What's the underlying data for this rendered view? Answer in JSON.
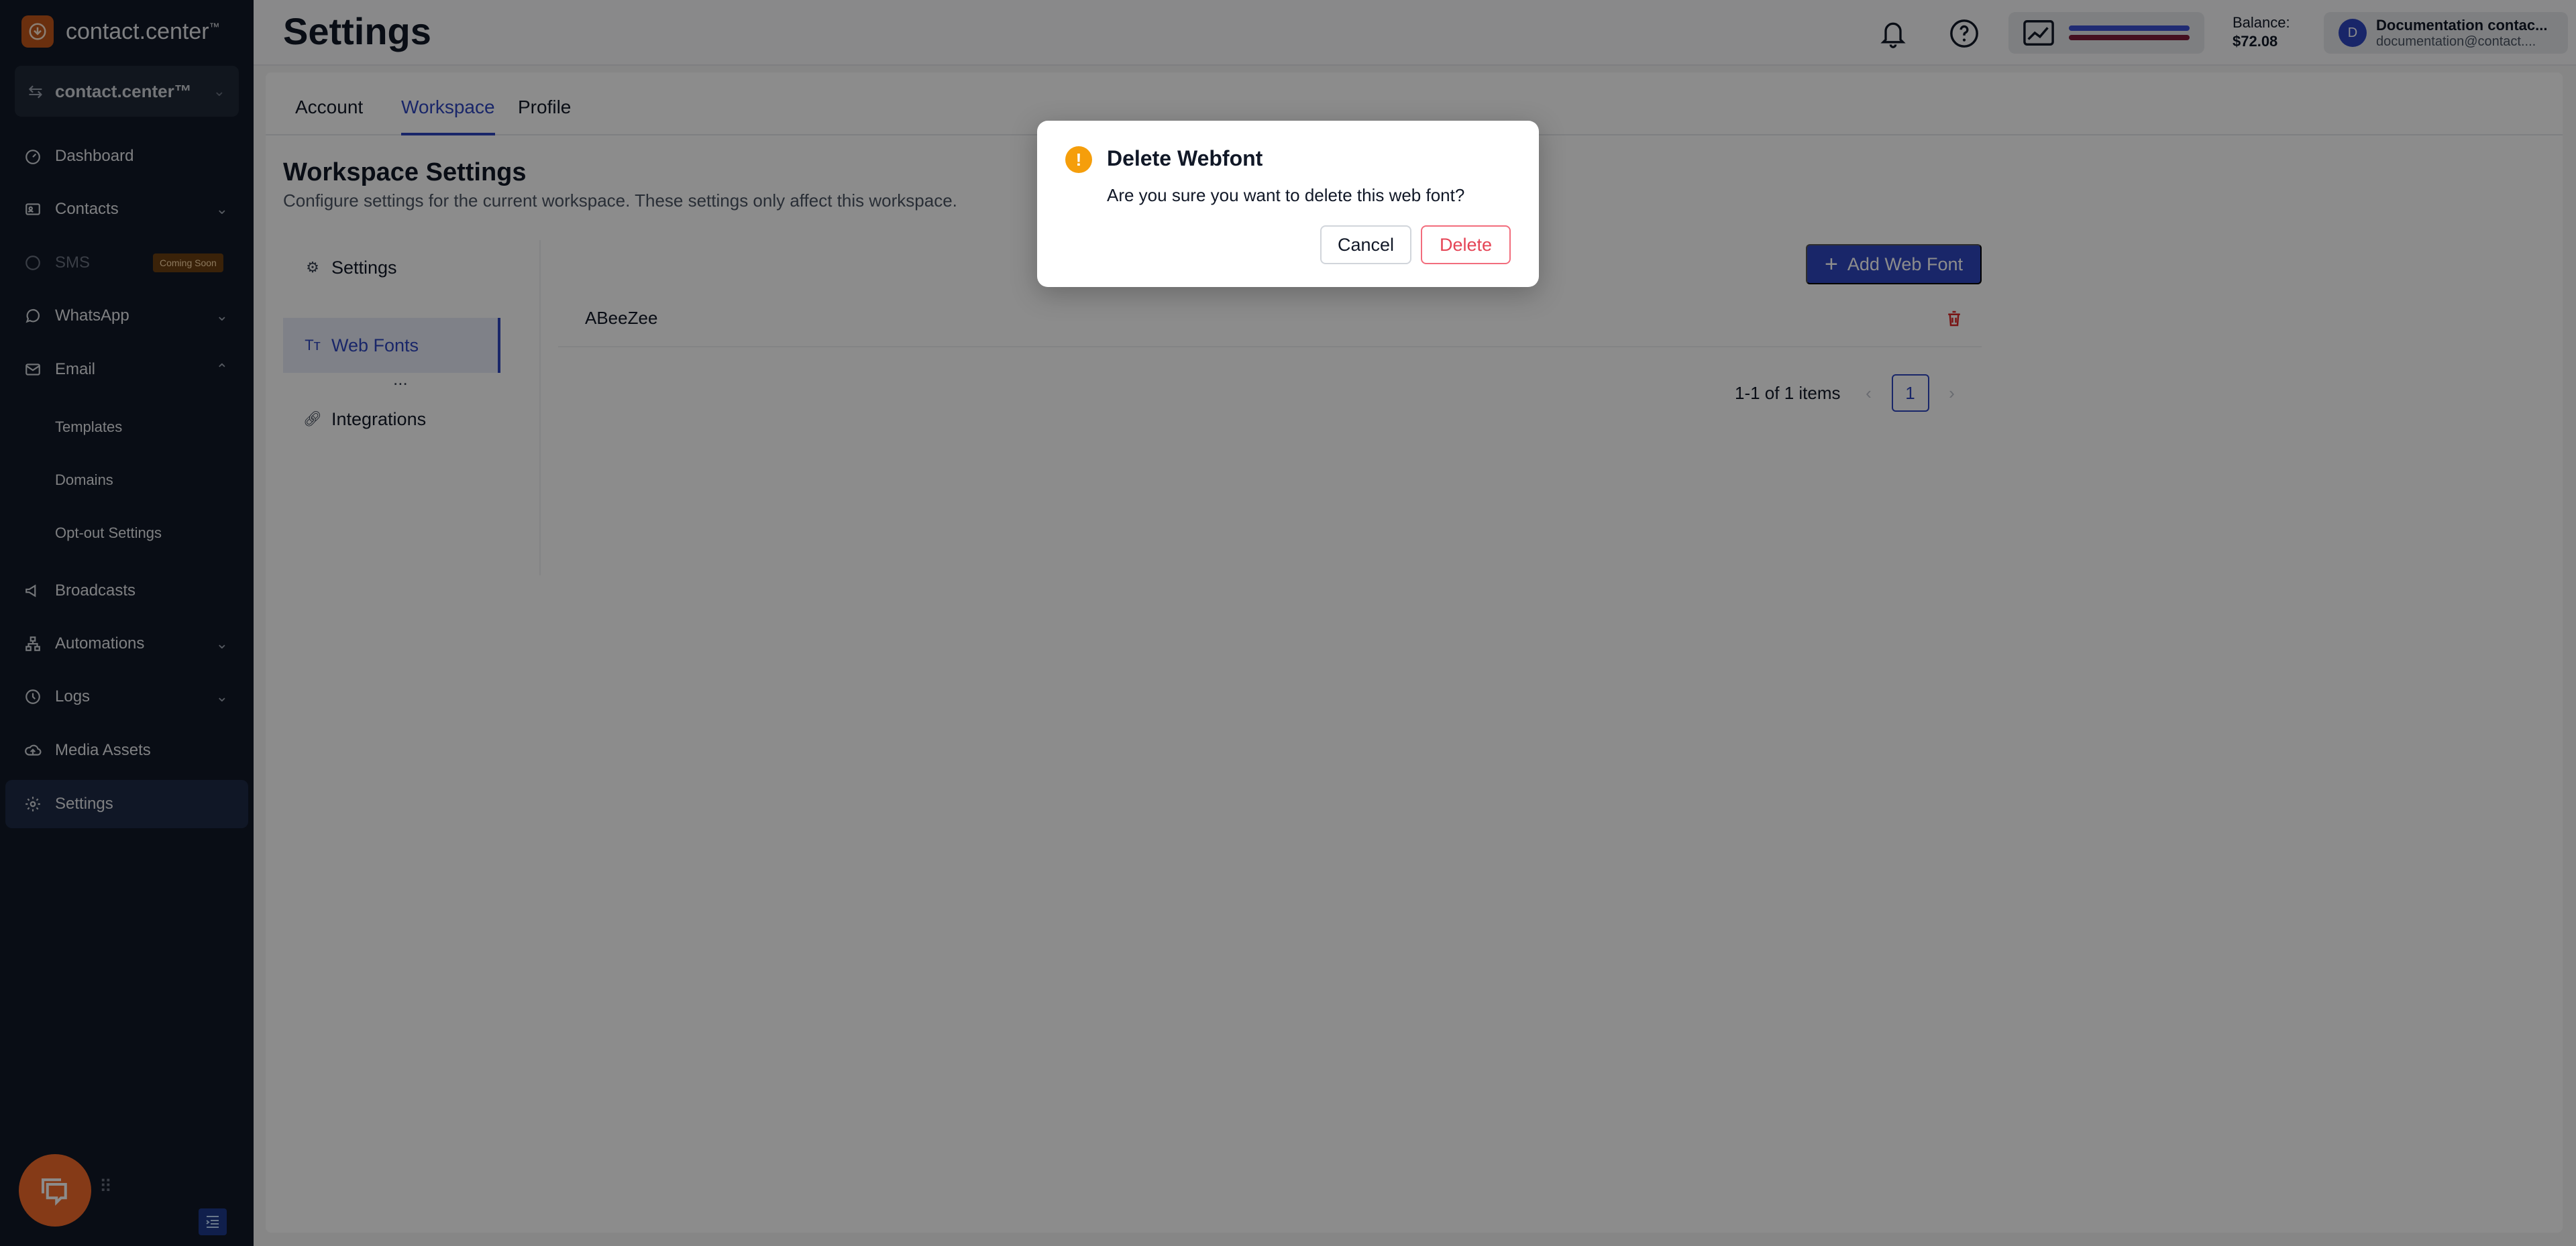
{
  "app": {
    "brand_name": "contact.center",
    "brand_mark": "™",
    "workspace_name": "contact.center™"
  },
  "sidebar": {
    "items": [
      {
        "label": "Dashboard",
        "icon": "dashboard-icon"
      },
      {
        "label": "Contacts",
        "icon": "contacts-icon"
      },
      {
        "label": "SMS",
        "icon": "sms-icon",
        "badge": "Coming Soon"
      },
      {
        "label": "WhatsApp",
        "icon": "whatsapp-icon"
      },
      {
        "label": "Email",
        "icon": "email-icon"
      },
      {
        "label": "Broadcasts",
        "icon": "megaphone-icon"
      },
      {
        "label": "Automations",
        "icon": "automations-icon"
      },
      {
        "label": "Logs",
        "icon": "logs-icon"
      },
      {
        "label": "Media Assets",
        "icon": "cloud-upload-icon"
      },
      {
        "label": "Settings",
        "icon": "gear-icon"
      }
    ],
    "email_sub": [
      "Templates",
      "Domains",
      "Opt-out Settings"
    ]
  },
  "header": {
    "title": "Settings",
    "balance_label": "Balance:",
    "balance_value": "$72.08",
    "user_name": "Documentation contac...",
    "user_email": "documentation@contact....",
    "user_initial": "D",
    "bar_colors": [
      "#3b4fd1",
      "#7f1d3a"
    ]
  },
  "tabs": [
    "Account",
    "Workspace",
    "Profile"
  ],
  "workspace": {
    "title": "Workspace Settings",
    "description": "Configure settings for the current workspace. These settings only affect this workspace.",
    "subnav": [
      "Settings",
      "Web Fonts",
      "Integrations"
    ],
    "more": "...",
    "add_button": "Add Web Font",
    "fonts": [
      "ABeeZee"
    ],
    "pagination": {
      "summary": "1-1 of 1 items",
      "page": "1"
    }
  },
  "modal": {
    "icon": "!",
    "title": "Delete Webfont",
    "message": "Are you sure you want to delete this web font?",
    "cancel": "Cancel",
    "delete": "Delete"
  },
  "colors": {
    "accent": "#2f46c0",
    "danger": "#e54556",
    "warning": "#f59e0b",
    "chat": "#f26b2a"
  }
}
